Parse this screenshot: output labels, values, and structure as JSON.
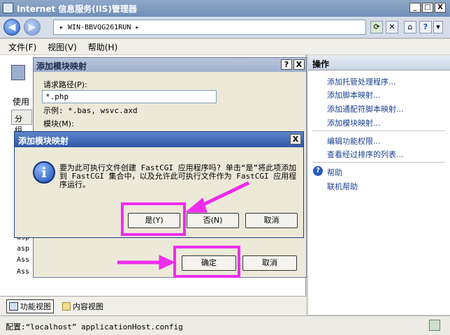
{
  "window": {
    "title": "Internet 信息服务(IIS)管理器",
    "minimize": "_",
    "maximize": "□",
    "close": "X"
  },
  "nav": {
    "back": "◀",
    "forward": "▶",
    "address": "▸  WIN-BBVQG261RUN  ▸"
  },
  "menu": {
    "file": "文件(F)",
    "view": "视图(V)",
    "help": "帮助(H)"
  },
  "left": {
    "using_label": "使用",
    "group_label": "分组",
    "rows": [
      "asp",
      "asp",
      "Ass",
      "Ass"
    ]
  },
  "tabs": {
    "features_view": "功能视图",
    "content_view": "内容视图"
  },
  "actions": {
    "header": "操作",
    "items": [
      "添加托管处理程序...",
      "添加脚本映射...",
      "添加通配符脚本映射...",
      "添加模块映射...",
      "编辑功能权限...",
      "查看经过排序的列表...",
      "帮助",
      "联机帮助"
    ]
  },
  "status": {
    "text": "配置:“localhost” applicationHost.config"
  },
  "dialog1": {
    "title": "添加模块映射",
    "help_btn": "?",
    "close_btn": "X",
    "path_label": "请求路径(P):",
    "path_value": "*.php",
    "example": "示例: *.bas, wsvc.axd",
    "module_label": "模块(M):",
    "ok": "确定",
    "cancel": "取消"
  },
  "dialog2": {
    "title": "添加模块映射",
    "close_btn": "X",
    "message": "要为此可执行文件创建 FastCGI 应用程序吗? 单击“是”将此项添加到 FastCGI 集合中，以及允许此可执行文件作为 FastCGI 应用程序运行。",
    "yes": "是(Y)",
    "no": "否(N)",
    "cancel": "取消"
  }
}
